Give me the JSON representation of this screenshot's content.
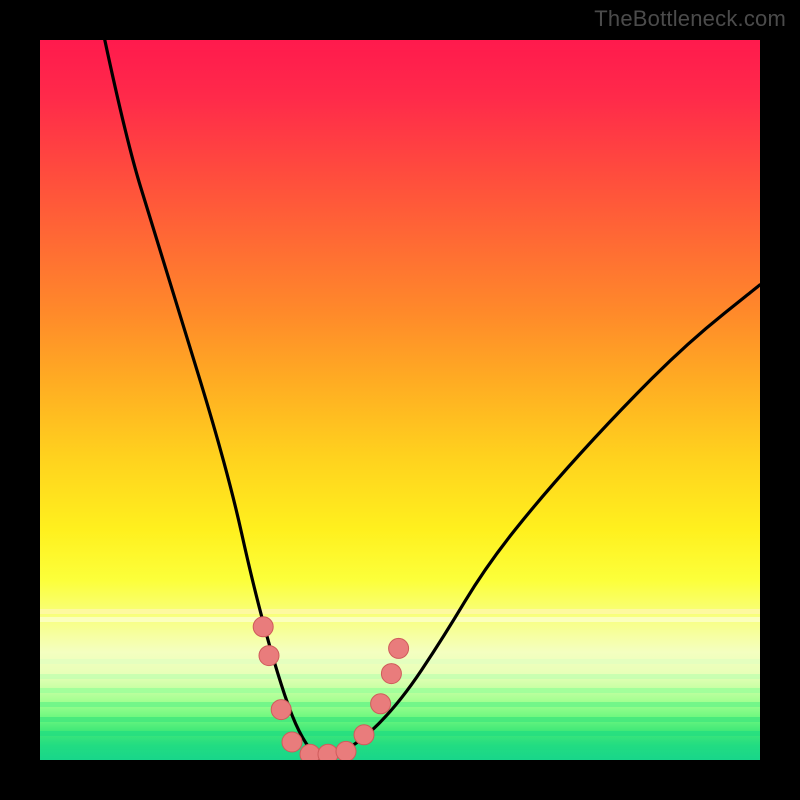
{
  "watermark": "TheBottleneck.com",
  "colors": {
    "frame": "#000000",
    "curve_stroke": "#000000",
    "marker_fill": "#e97c7c",
    "marker_stroke": "#cf5b5b"
  },
  "chart_data": {
    "type": "line",
    "title": "",
    "xlabel": "",
    "ylabel": "",
    "xlim": [
      0,
      100
    ],
    "ylim": [
      0,
      100
    ],
    "background_gradient": {
      "direction": "vertical",
      "stops": [
        {
          "pos": 0,
          "color": "#ff1a4d"
        },
        {
          "pos": 50,
          "color": "#ffd21e"
        },
        {
          "pos": 85,
          "color": "#f4ffc0"
        },
        {
          "pos": 100,
          "color": "#18d68a"
        }
      ]
    },
    "series": [
      {
        "name": "bottleneck-curve",
        "x": [
          9,
          12,
          16,
          20,
          24,
          27,
          29,
          31,
          33,
          35,
          37,
          39,
          44,
          50,
          56,
          62,
          70,
          80,
          90,
          100
        ],
        "y": [
          100,
          86,
          73,
          60,
          47,
          36,
          27,
          19,
          12,
          6,
          2,
          0,
          2,
          8,
          17,
          27,
          37,
          48,
          58,
          66
        ]
      }
    ],
    "markers": [
      {
        "x": 31.0,
        "y": 18.5
      },
      {
        "x": 31.8,
        "y": 14.5
      },
      {
        "x": 33.5,
        "y": 7.0
      },
      {
        "x": 35.0,
        "y": 2.5
      },
      {
        "x": 37.5,
        "y": 0.8
      },
      {
        "x": 40.0,
        "y": 0.8
      },
      {
        "x": 42.5,
        "y": 1.2
      },
      {
        "x": 45.0,
        "y": 3.5
      },
      {
        "x": 47.3,
        "y": 7.8
      },
      {
        "x": 48.8,
        "y": 12.0
      },
      {
        "x": 49.8,
        "y": 15.5
      }
    ]
  }
}
